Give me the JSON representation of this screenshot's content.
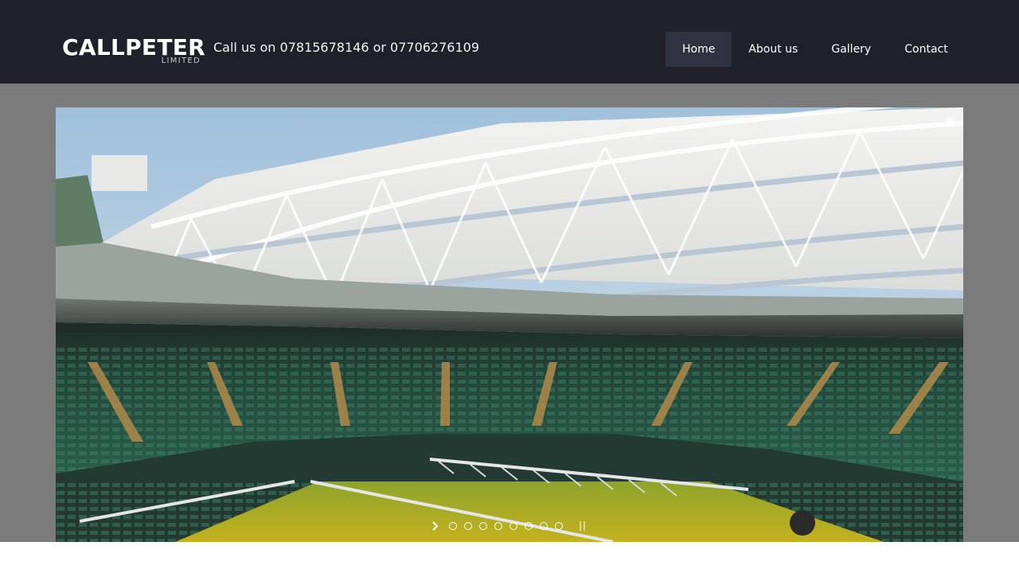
{
  "header": {
    "logo_text": "CALLPETER",
    "logo_subtext": "LIMITED",
    "phone_text": "Call us on 07815678146 or 07706276109"
  },
  "nav": {
    "items": [
      {
        "label": "Home",
        "active": true
      },
      {
        "label": "About us",
        "active": false
      },
      {
        "label": "Gallery",
        "active": false
      },
      {
        "label": "Contact",
        "active": false
      }
    ]
  },
  "slider": {
    "image": "tennis-stadium-roof-photo",
    "slide_count": 8,
    "current_slide": 1,
    "icons": {
      "next": "chevron-right-icon",
      "pause": "pause-icon"
    }
  },
  "colors": {
    "header_bg": "#1f2029",
    "nav_active_bg": "#2f3241",
    "band_bg": "#7b7b7b"
  }
}
